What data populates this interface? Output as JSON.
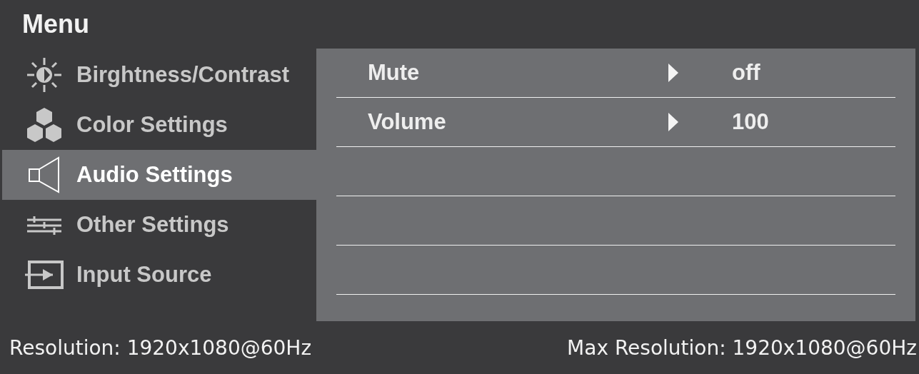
{
  "title": "Menu",
  "sidebar": {
    "items": [
      {
        "label": "Birghtness/Contrast",
        "selected": false
      },
      {
        "label": "Color Settings",
        "selected": false
      },
      {
        "label": "Audio Settings",
        "selected": true
      },
      {
        "label": "Other Settings",
        "selected": false
      },
      {
        "label": "Input Source",
        "selected": false
      }
    ]
  },
  "panel": {
    "rows": [
      {
        "label": "Mute",
        "value": "off"
      },
      {
        "label": "Volume",
        "value": "100"
      }
    ]
  },
  "status_bar": {
    "resolution": "Resolution: 1920x1080@60Hz",
    "max_resolution": "Max Resolution: 1920x1080@60Hz"
  }
}
